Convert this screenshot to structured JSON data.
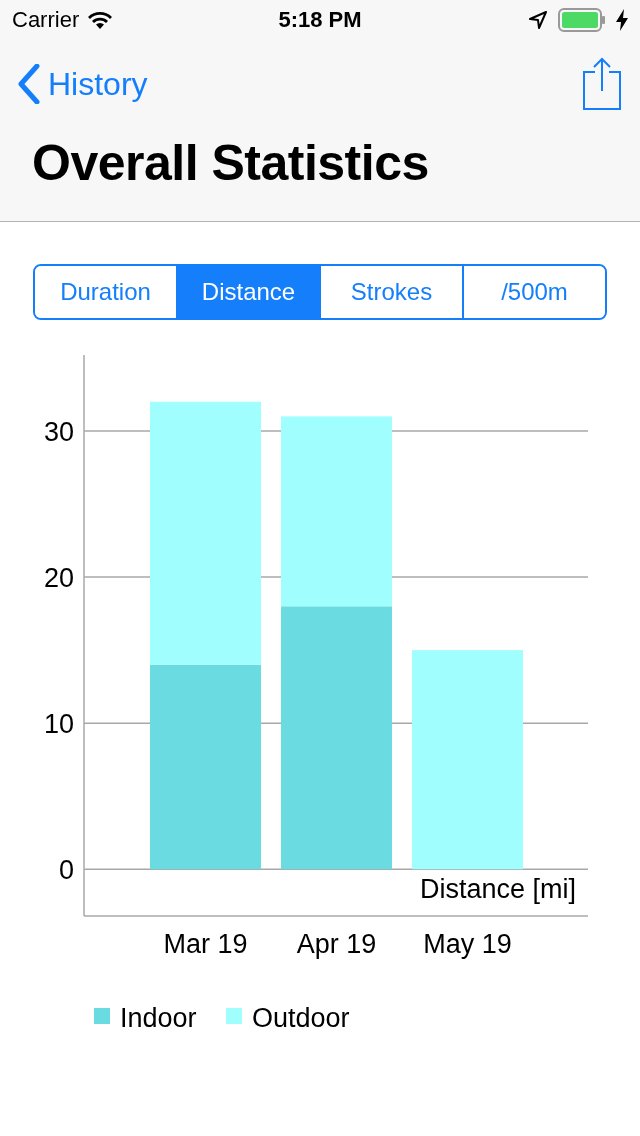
{
  "status_bar": {
    "carrier": "Carrier",
    "time": "5:18 PM"
  },
  "nav": {
    "back": "History",
    "title": "Overall Statistics"
  },
  "tabs": [
    {
      "label": "Duration",
      "selected": false
    },
    {
      "label": "Distance",
      "selected": true
    },
    {
      "label": "Strokes",
      "selected": false
    },
    {
      "label": "/500m",
      "selected": false
    }
  ],
  "chart_data": {
    "type": "bar",
    "stacked": true,
    "grid": true,
    "legend": true,
    "xlabel": "Distance [mi]",
    "categories": [
      "Mar 19",
      "Apr 19",
      "May 19"
    ],
    "ylim": [
      -3.2,
      35.2
    ],
    "yticks": [
      0,
      10,
      20,
      30
    ],
    "series": [
      {
        "name": "Indoor",
        "color": "#6adce1",
        "values": [
          14,
          18,
          0
        ]
      },
      {
        "name": "Outdoor",
        "color": "#a0fffe",
        "values": [
          18,
          13,
          15
        ]
      }
    ]
  }
}
